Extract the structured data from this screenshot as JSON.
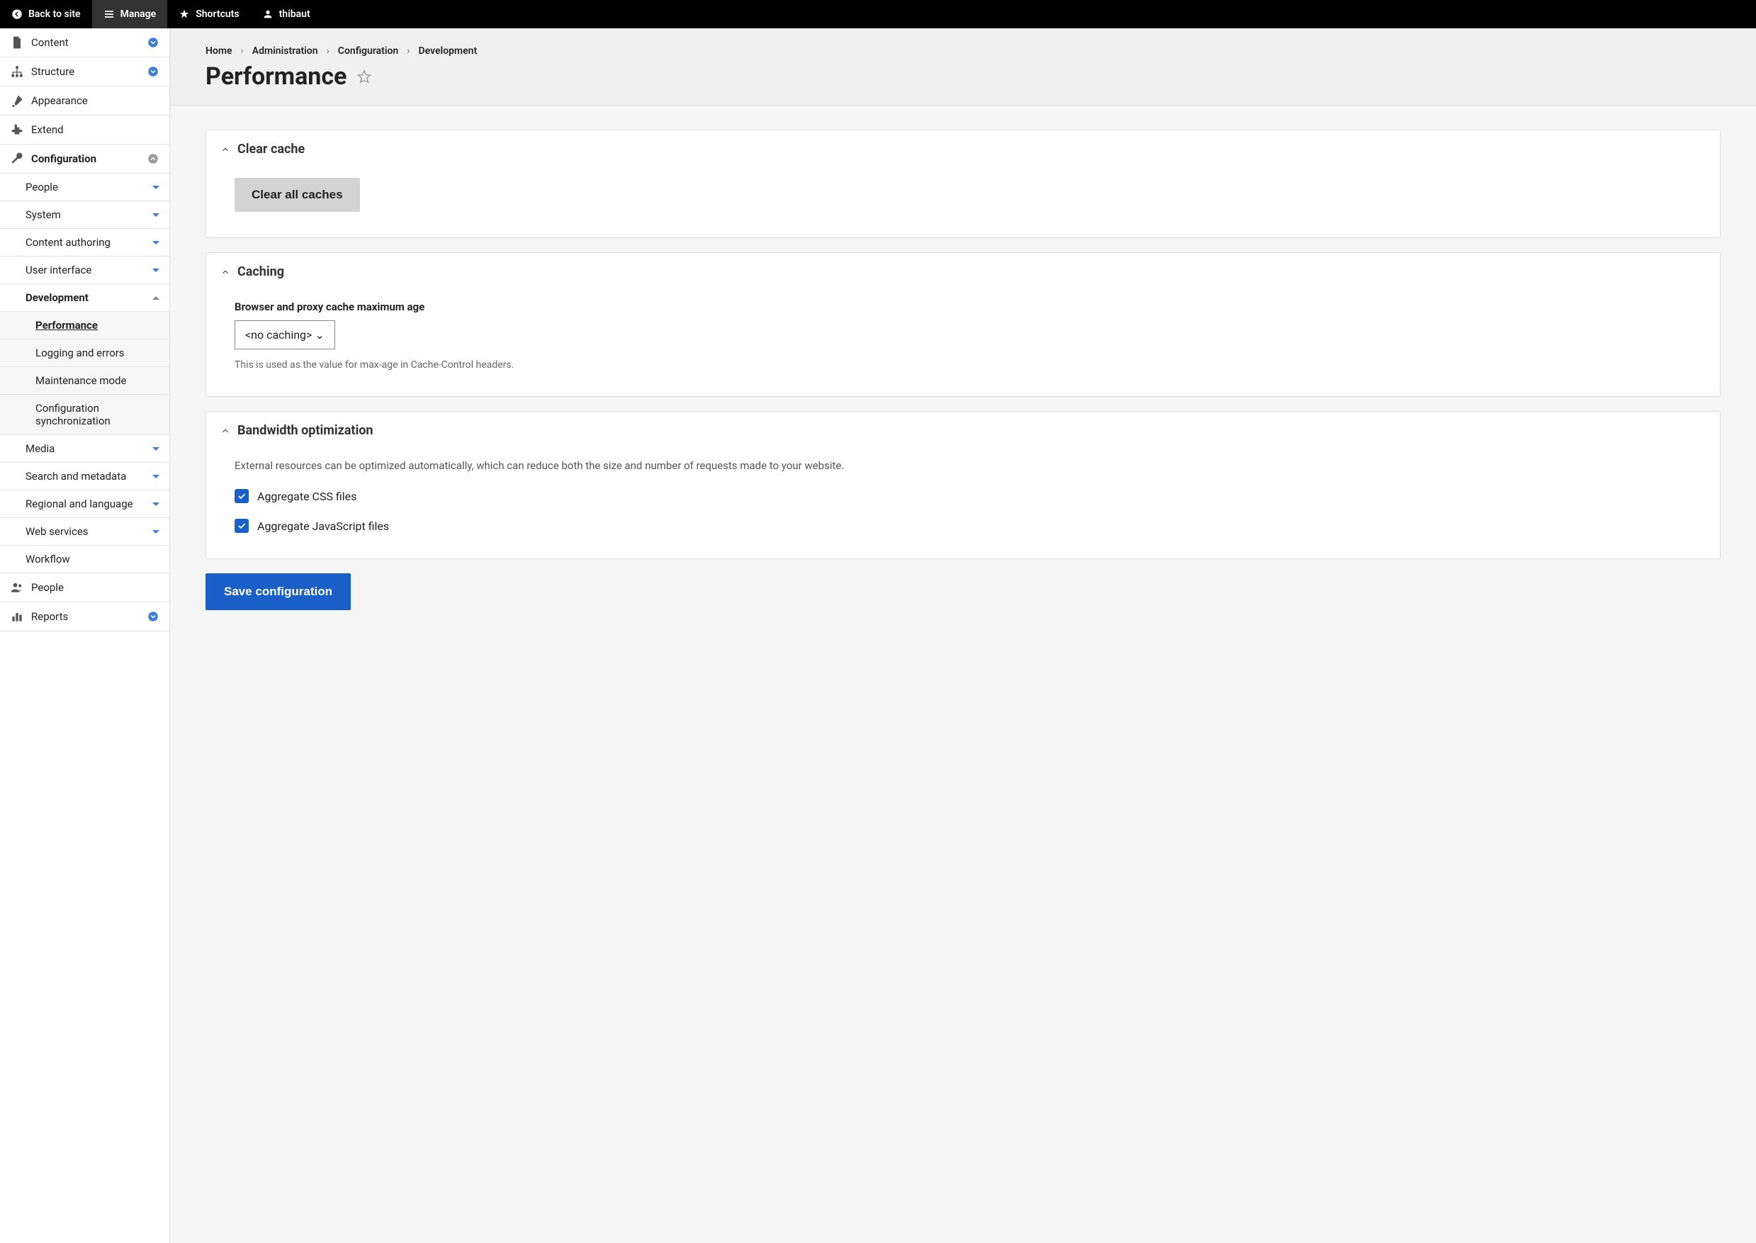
{
  "toolbar": {
    "back": "Back to site",
    "manage": "Manage",
    "shortcuts": "Shortcuts",
    "user": "thibaut"
  },
  "sidebar": {
    "content": "Content",
    "structure": "Structure",
    "appearance": "Appearance",
    "extend": "Extend",
    "configuration": "Configuration",
    "config_sub": {
      "people": "People",
      "system": "System",
      "content_authoring": "Content authoring",
      "user_interface": "User interface",
      "development": "Development",
      "dev_sub": {
        "performance": "Performance",
        "logging": "Logging and errors",
        "maintenance": "Maintenance mode",
        "config_sync": "Configuration synchronization"
      },
      "media": "Media",
      "search": "Search and metadata",
      "regional": "Regional and language",
      "web_services": "Web services",
      "workflow": "Workflow"
    },
    "people": "People",
    "reports": "Reports"
  },
  "breadcrumb": [
    "Home",
    "Administration",
    "Configuration",
    "Development"
  ],
  "page_title": "Performance",
  "panels": {
    "clear_cache": {
      "title": "Clear cache",
      "button": "Clear all caches"
    },
    "caching": {
      "title": "Caching",
      "field_label": "Browser and proxy cache maximum age",
      "select_value": "<no caching>",
      "help": "This is used as the value for max-age in Cache-Control headers."
    },
    "bandwidth": {
      "title": "Bandwidth optimization",
      "desc": "External resources can be optimized automatically, which can reduce both the size and number of requests made to your website.",
      "css": "Aggregate CSS files",
      "js": "Aggregate JavaScript files"
    }
  },
  "save_button": "Save configuration"
}
